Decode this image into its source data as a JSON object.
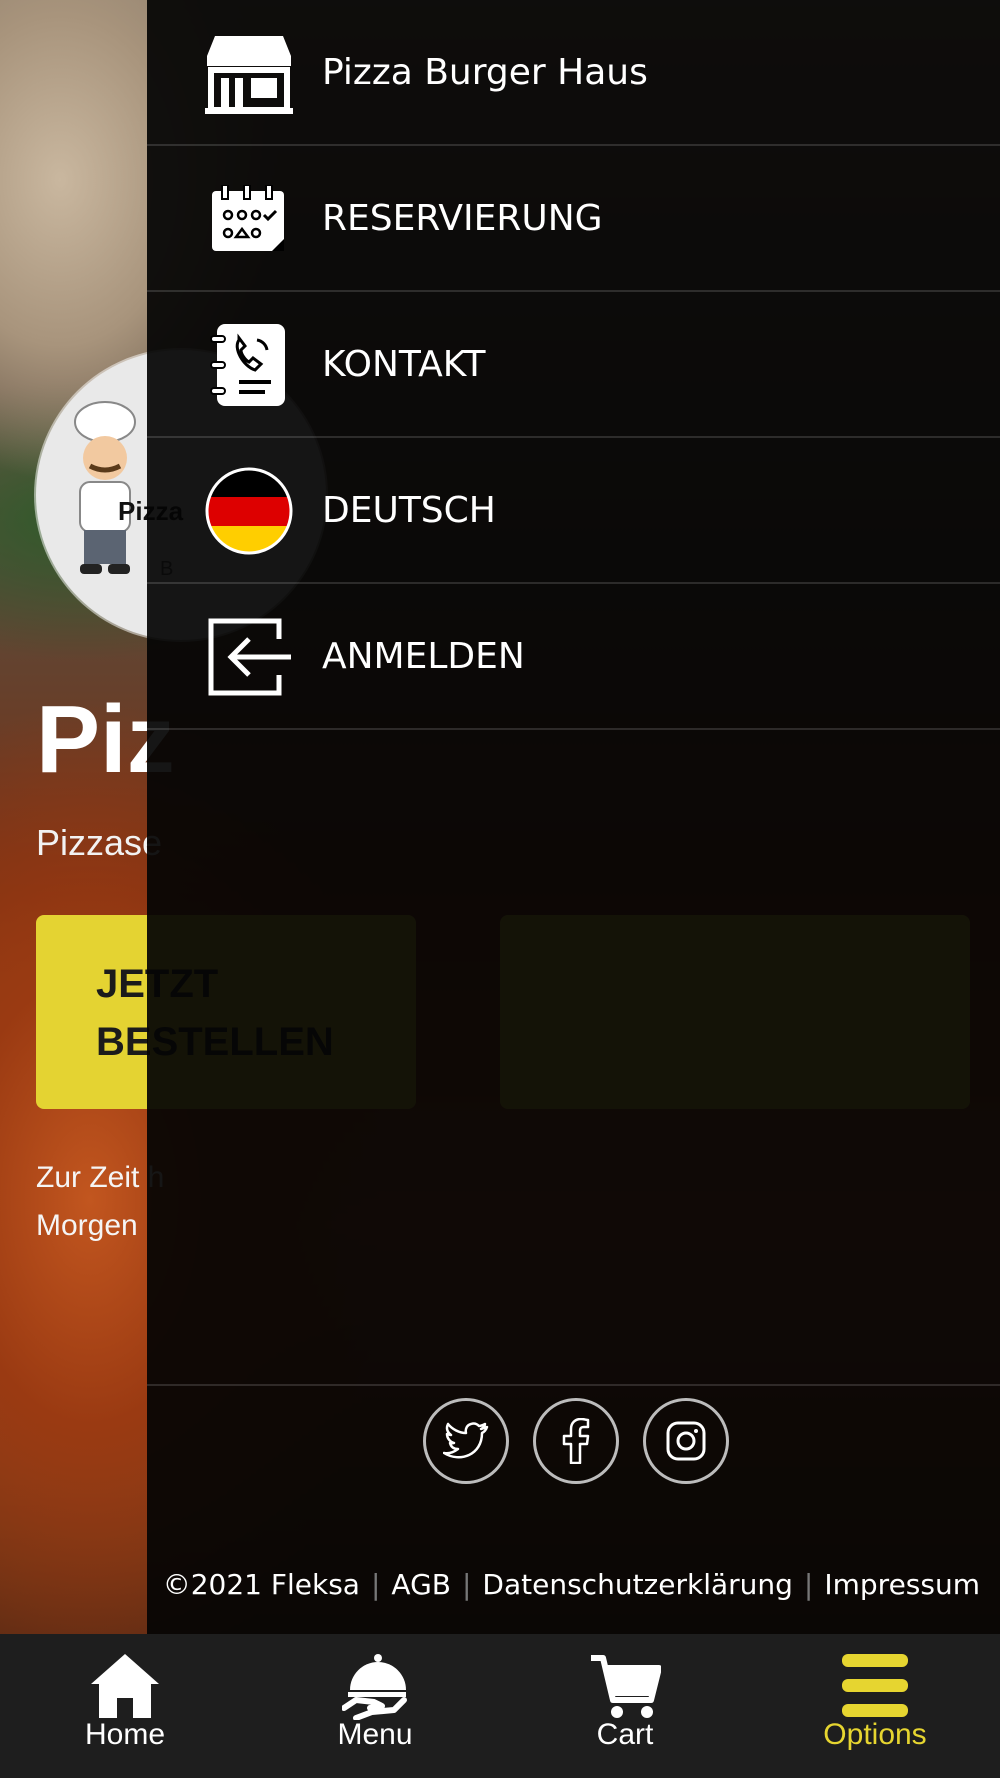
{
  "background": {
    "logo_text": "Pizza",
    "logo_sub": "B",
    "hero_title": "Piz",
    "hero_subtitle": "Pizzase",
    "order_button_label": "JETZT BESTELLEN",
    "status_text": "Zur Zeit h\nMorgen"
  },
  "drawer": {
    "items": [
      {
        "label": "Pizza Burger Haus",
        "icon": "store-icon"
      },
      {
        "label": "RESERVIERUNG",
        "icon": "calendar-icon"
      },
      {
        "label": "KONTAKT",
        "icon": "contact-book-icon"
      },
      {
        "label": "DEUTSCH",
        "icon": "german-flag-icon"
      },
      {
        "label": "ANMELDEN",
        "icon": "login-icon"
      }
    ],
    "socials": [
      "twitter-icon",
      "facebook-icon",
      "instagram-icon"
    ],
    "legal": {
      "copyright": "©2021 Fleksa",
      "agb": "AGB",
      "privacy": "Datenschutzerklärung",
      "imprint": "Impressum"
    }
  },
  "bottom_nav": {
    "items": [
      {
        "label": "Home",
        "icon": "home-icon"
      },
      {
        "label": "Menu",
        "icon": "cloche-icon"
      },
      {
        "label": "Cart",
        "icon": "cart-icon"
      },
      {
        "label": "Options",
        "icon": "hamburger-icon",
        "active": true
      }
    ]
  },
  "colors": {
    "accent": "#e6d530",
    "drawer_bg": "#040404",
    "nav_bg": "#1e1e1e"
  }
}
